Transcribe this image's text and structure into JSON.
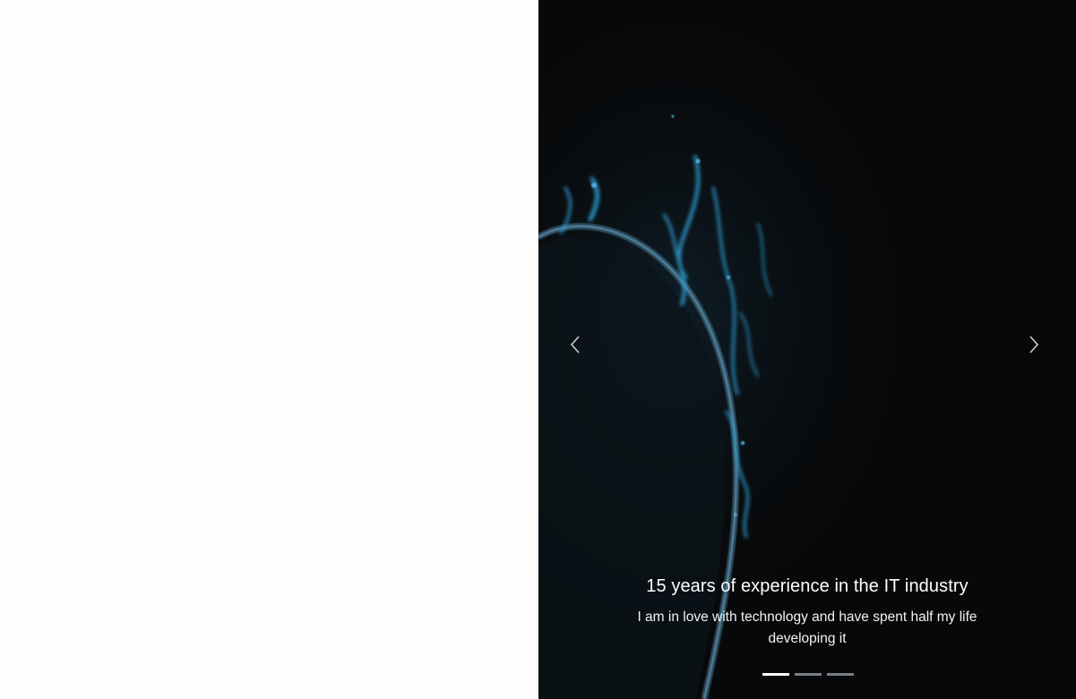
{
  "carousel": {
    "slide": {
      "title": "15 years of experience in the IT industry",
      "text": "I am in love with technology and have spent half my life developing it"
    },
    "prev_icon": "chevron-left-icon",
    "next_icon": "chevron-right-icon",
    "indicator_count": 3,
    "active_indicator": 0,
    "colors": {
      "background": "#070809",
      "accent_glow": "#3aa7d8",
      "indicator_active": "#ffffff",
      "indicator_inactive": "#7c7f83"
    }
  }
}
